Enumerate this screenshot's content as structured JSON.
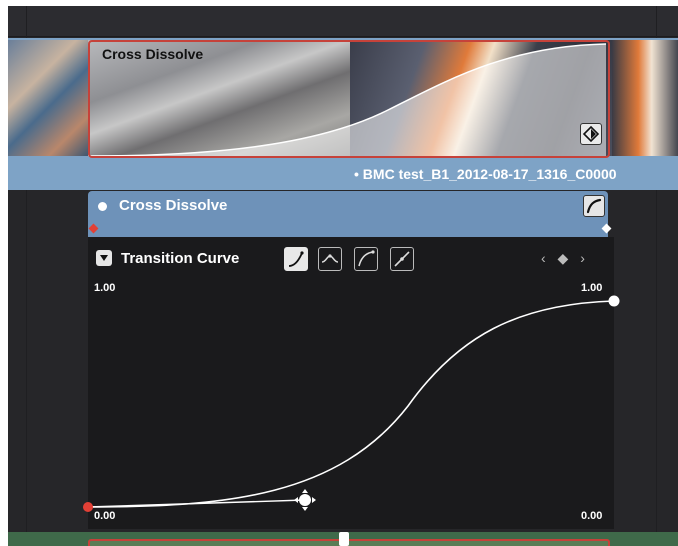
{
  "timeline": {
    "transition_clip_title": "Cross Dissolve",
    "next_clip_label": "• BMC test_B1_2012-08-17_1316_C0000"
  },
  "inspector": {
    "header_title": "Cross Dissolve",
    "curve_panel": {
      "title": "Transition Curve",
      "nav": "‹ ◆ ›",
      "y_max_left": "1.00",
      "y_max_right": "1.00",
      "y_min_left": "0.00",
      "y_min_right": "0.00",
      "presets": [
        "ease-in-preset-icon",
        "ease-in-out-preset-icon",
        "ease-out-preset-icon",
        "linear-preset-icon"
      ]
    }
  },
  "colors": {
    "clip_border": "#c6423a",
    "track_blue": "#7ea3c6",
    "header_blue": "#6e92b9",
    "keyframe_red": "#e24036"
  }
}
